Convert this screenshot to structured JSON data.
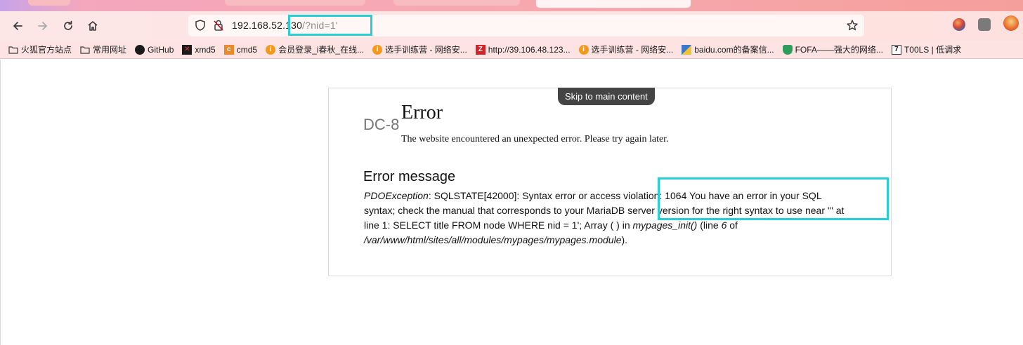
{
  "browser": {
    "url": {
      "host": "192.168.52.130",
      "path": "/?nid=1'"
    },
    "colors": {
      "highlight": "#27cfd3",
      "toolbar_bg": "#fde6e6"
    },
    "icons": {
      "back": "arrow-left-icon",
      "forward": "arrow-right-icon",
      "reload": "reload-icon",
      "home": "home-icon",
      "tracking": "shield-icon",
      "insecure": "lock-slash-icon",
      "bookmark_star": "star-icon"
    }
  },
  "bookmarks": [
    {
      "label": "火狐官方站点",
      "icon": "folder-icon"
    },
    {
      "label": "常用网址",
      "icon": "folder-icon"
    },
    {
      "label": "GitHub",
      "icon": "github-icon"
    },
    {
      "label": "xmd5",
      "icon": "xmd5-icon"
    },
    {
      "label": "cmd5",
      "icon": "cmd5-icon"
    },
    {
      "label": "会员登录_i春秋_在线...",
      "icon": "ichunqiu-icon"
    },
    {
      "label": "选手训练营 - 网络安...",
      "icon": "ichunqiu-icon"
    },
    {
      "label": "http://39.106.48.123...",
      "icon": "z-icon"
    },
    {
      "label": "选手训练营 - 网络安...",
      "icon": "ichunqiu-icon"
    },
    {
      "label": "baidu.com的备案信...",
      "icon": "baidu-icon"
    },
    {
      "label": "FOFA——强大的网络...",
      "icon": "fofa-icon"
    },
    {
      "label": "T00LS | 低调求",
      "icon": "t00ls-icon"
    }
  ],
  "page": {
    "skip_link": "Skip to main content",
    "site_name": "DC-8",
    "title": "Error",
    "description": "The website encountered an unexpected error. Please try again later.",
    "message_heading": "Error message",
    "message": {
      "exception": "PDOException",
      "part1": ": SQLSTATE[42000]: Syntax error or access violation: 1064 You have an error in your SQL syntax; check the manual that corresponds to your MariaDB server version for the right syntax to use near ''' at line 1: SELECT title FROM node WHERE nid = 1'; Array ( ) in ",
      "function": "mypages_init()",
      "part2": " (line ",
      "line": "6",
      "part3": " of ",
      "file": "/var/www/html/sites/all/modules/mypages/mypages.module",
      "part4": ")."
    }
  }
}
